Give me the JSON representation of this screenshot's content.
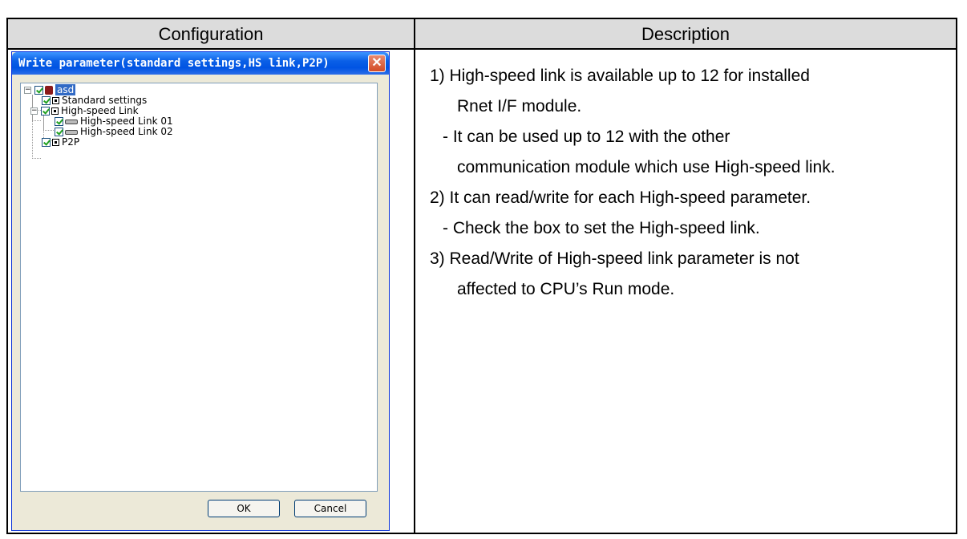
{
  "table": {
    "header_config": "Configuration",
    "header_desc": "Description"
  },
  "dialog": {
    "title": "Write parameter(standard settings,HS link,P2P)",
    "close_glyph": "✕",
    "tree": {
      "root": "asd",
      "standard_settings": "Standard settings",
      "hs_link": "High-speed Link",
      "hs_link_01": "High-speed Link 01",
      "hs_link_02": "High-speed Link 02",
      "p2p": "P2P"
    },
    "ok_label": "OK",
    "cancel_label": "Cancel"
  },
  "description": {
    "lines": [
      "1)  High-speed link is available up to 12 for installed",
      "Rnet I/F module.",
      "- It can be used up to 12 with the other",
      "communication module which use High-speed link.",
      "2)  It can read/write for each High-speed parameter.",
      "- Check the box to set the High-speed link.",
      "3)  Read/Write of High-speed link parameter is not",
      "affected to CPU’s Run mode."
    ]
  },
  "colors": {
    "header_bg": "#dcdcdc",
    "titlebar": "#0054e3",
    "selection": "#316ac5"
  }
}
